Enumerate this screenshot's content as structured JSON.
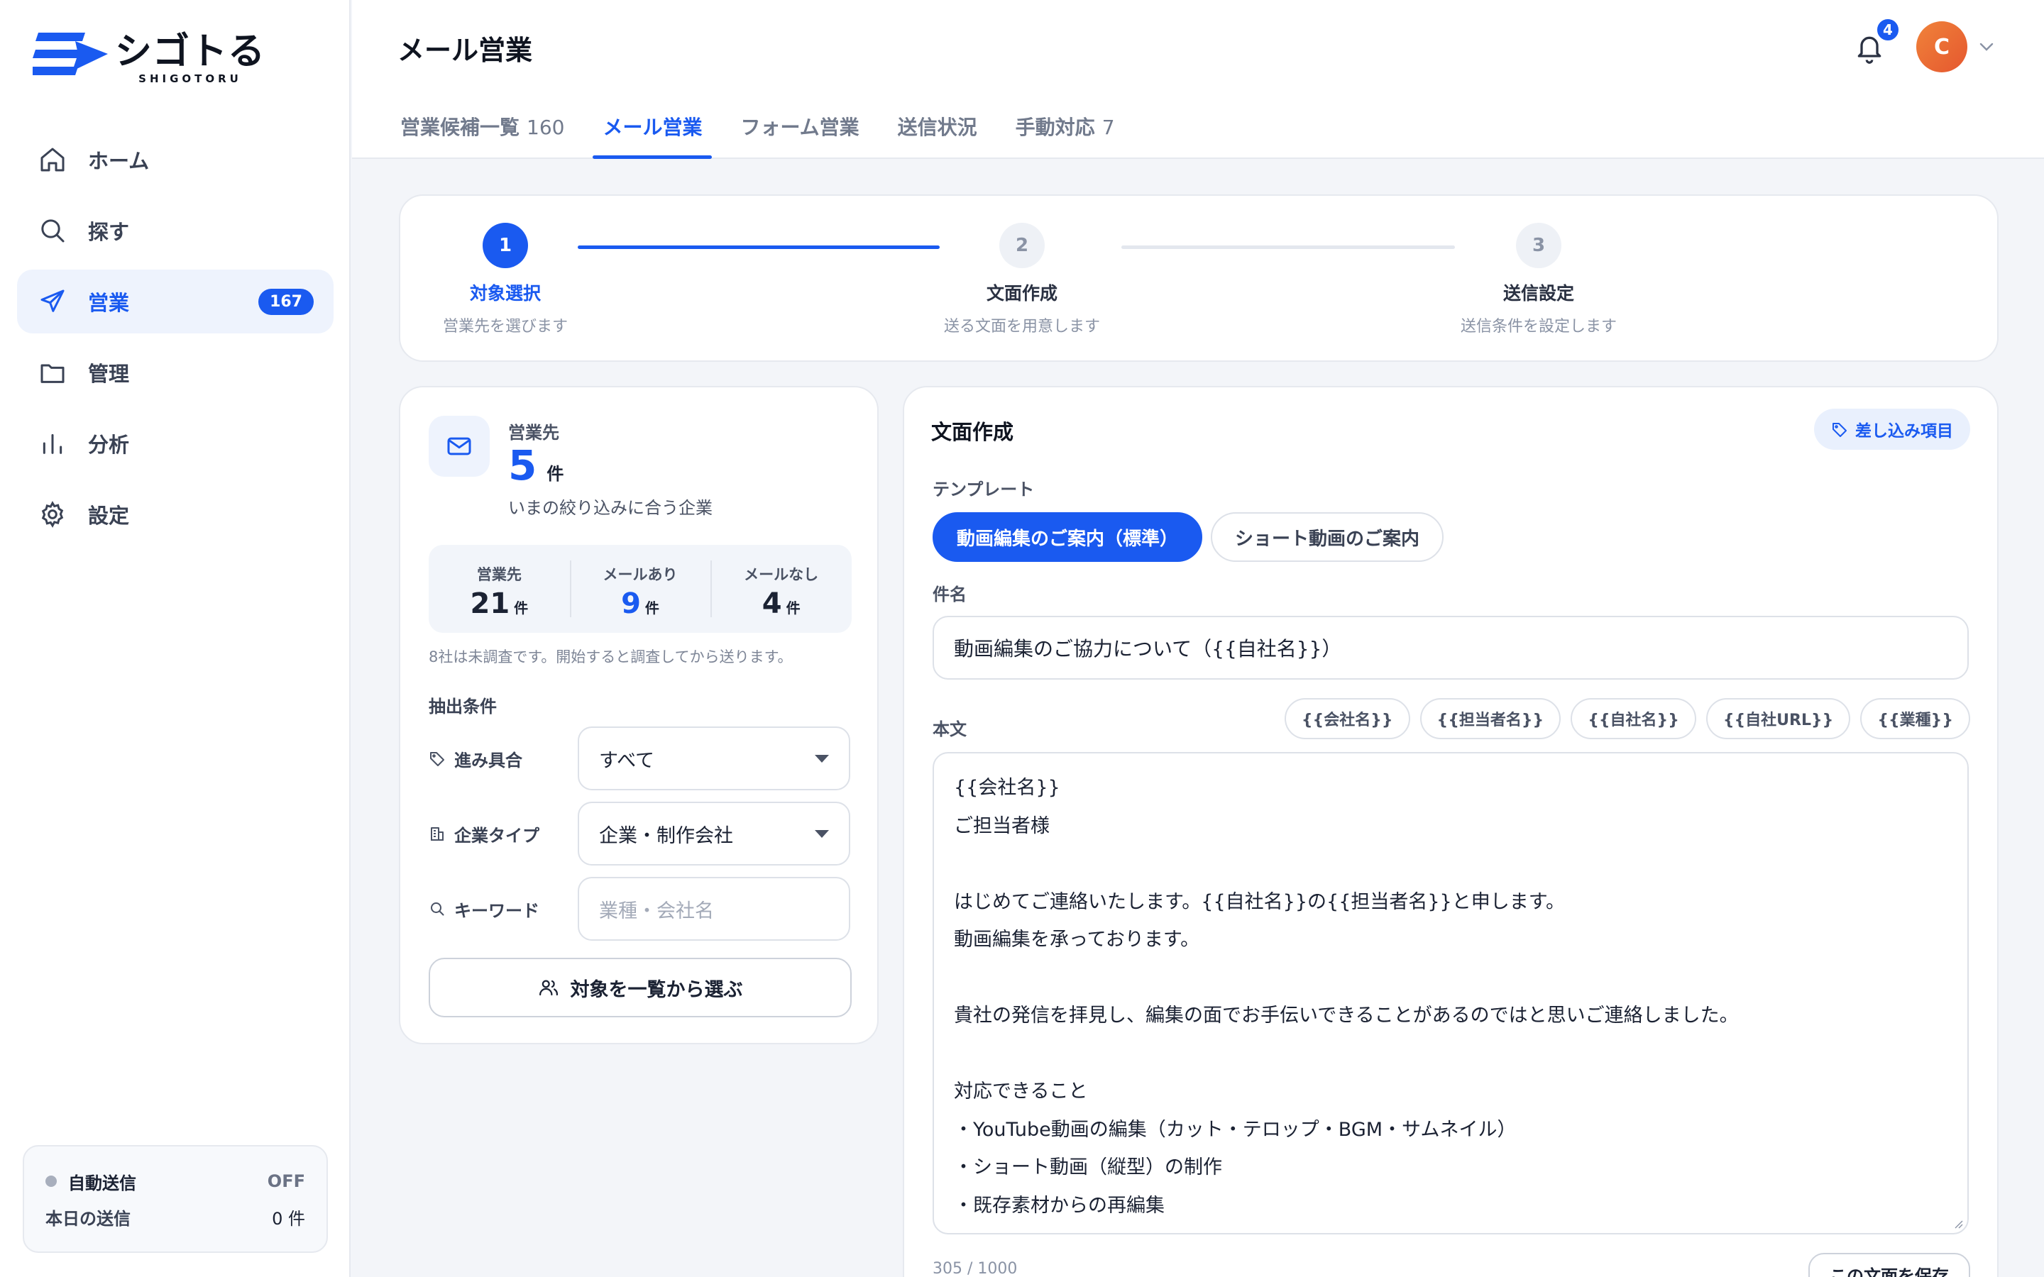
{
  "app": {
    "logo_text": "シゴトる",
    "logo_sub": "SHIGOTORU"
  },
  "sidebar": {
    "items": [
      {
        "label": "ホーム",
        "icon": "home-icon"
      },
      {
        "label": "探す",
        "icon": "search-icon"
      },
      {
        "label": "営業",
        "icon": "send-icon",
        "badge": "167",
        "active": true
      },
      {
        "label": "管理",
        "icon": "folder-icon"
      },
      {
        "label": "分析",
        "icon": "bar-chart-icon"
      },
      {
        "label": "設定",
        "icon": "gear-icon"
      }
    ],
    "auto_send": {
      "label": "自動送信",
      "status": "OFF",
      "today_label": "本日の送信",
      "today_value": "0 件"
    }
  },
  "header": {
    "title": "メール営業",
    "tabs": [
      {
        "label": "営業候補一覧",
        "count": "160"
      },
      {
        "label": "メール営業",
        "count": "",
        "active": true
      },
      {
        "label": "フォーム営業",
        "count": ""
      },
      {
        "label": "送信状況",
        "count": ""
      },
      {
        "label": "手動対応",
        "count": "7"
      }
    ],
    "notifications": "4",
    "avatar_initial": "C"
  },
  "stepper": {
    "steps": [
      {
        "num": "1",
        "title": "対象選択",
        "sub": "営業先を選びます"
      },
      {
        "num": "2",
        "title": "文面作成",
        "sub": "送る文面を用意します"
      },
      {
        "num": "3",
        "title": "送信設定",
        "sub": "送信条件を設定します"
      }
    ]
  },
  "target": {
    "label": "営業先",
    "count": "5",
    "unit": "件",
    "desc": "いまの絞り込みに合う企業",
    "stats": [
      {
        "label": "営業先",
        "value": "21",
        "unit": "件"
      },
      {
        "label": "メールあり",
        "value": "9",
        "unit": "件"
      },
      {
        "label": "メールなし",
        "value": "4",
        "unit": "件"
      }
    ],
    "note": "8社は未調査です。開始すると調査してから送ります。",
    "conditions_title": "抽出条件",
    "progress_label": "進み具合",
    "progress_value": "すべて",
    "type_label": "企業タイプ",
    "type_value": "企業・制作会社",
    "keyword_label": "キーワード",
    "keyword_placeholder": "業種・会社名",
    "pick_button": "対象を一覧から選ぶ"
  },
  "compose": {
    "title": "文面作成",
    "merge_button": "差し込み項目",
    "template_label": "テンプレート",
    "templates": [
      "動画編集のご案内（標準）",
      "ショート動画のご案内"
    ],
    "subject_label": "件名",
    "subject_value": "動画編集のご協力について（{{自社名}}）",
    "body_label": "本文",
    "chips": [
      "{{会社名}}",
      "{{担当者名}}",
      "{{自社名}}",
      "{{自社URL}}",
      "{{業種}}"
    ],
    "body_lines": [
      "{{会社名}}",
      "ご担当者様",
      "",
      "はじめてご連絡いたします。{{自社名}}の{{担当者名}}と申します。",
      "動画編集を承っております。",
      "",
      "貴社の発信を拝見し、編集の面でお手伝いできることがあるのではと思いご連絡しました。",
      "",
      "対応できること",
      "・YouTube動画の編集（カット・テロップ・BGM・サムネイル）",
      "・ショート動画（縦型）の制作",
      "・既存素材からの再編集"
    ],
    "char_count": "305 / 1000",
    "save_button": "この文面を保存"
  },
  "colors": {
    "accent": "#1a5af0",
    "avatar": "#e5572f"
  }
}
